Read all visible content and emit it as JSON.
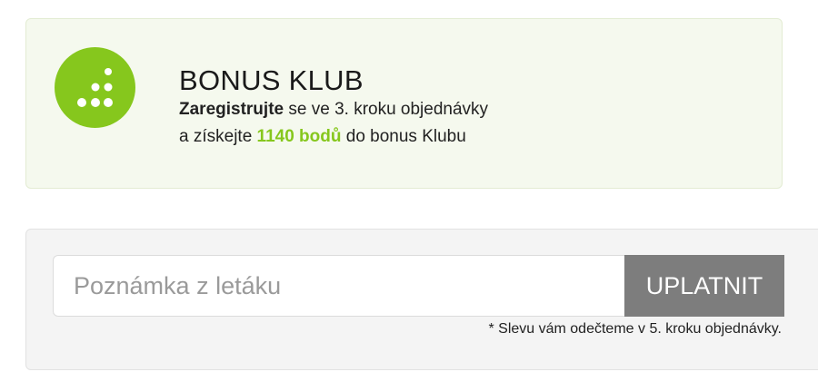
{
  "bonus": {
    "logo_icon": "bonus-dots-icon",
    "brand_color": "#86c71d",
    "title": "BONUS KLUB",
    "line1_bold": "Zaregistrujte",
    "line1_rest": " se ve 3. kroku objednávky",
    "line2_start": "a získejte ",
    "points": "1140 bodů",
    "line2_end": " do bonus Klubu"
  },
  "note": {
    "input_placeholder": "Poznámka z letáku",
    "input_value": "",
    "apply_label": "UPLATNIT",
    "hint": "* Slevu vám odečteme v 5. kroku objednávky."
  }
}
